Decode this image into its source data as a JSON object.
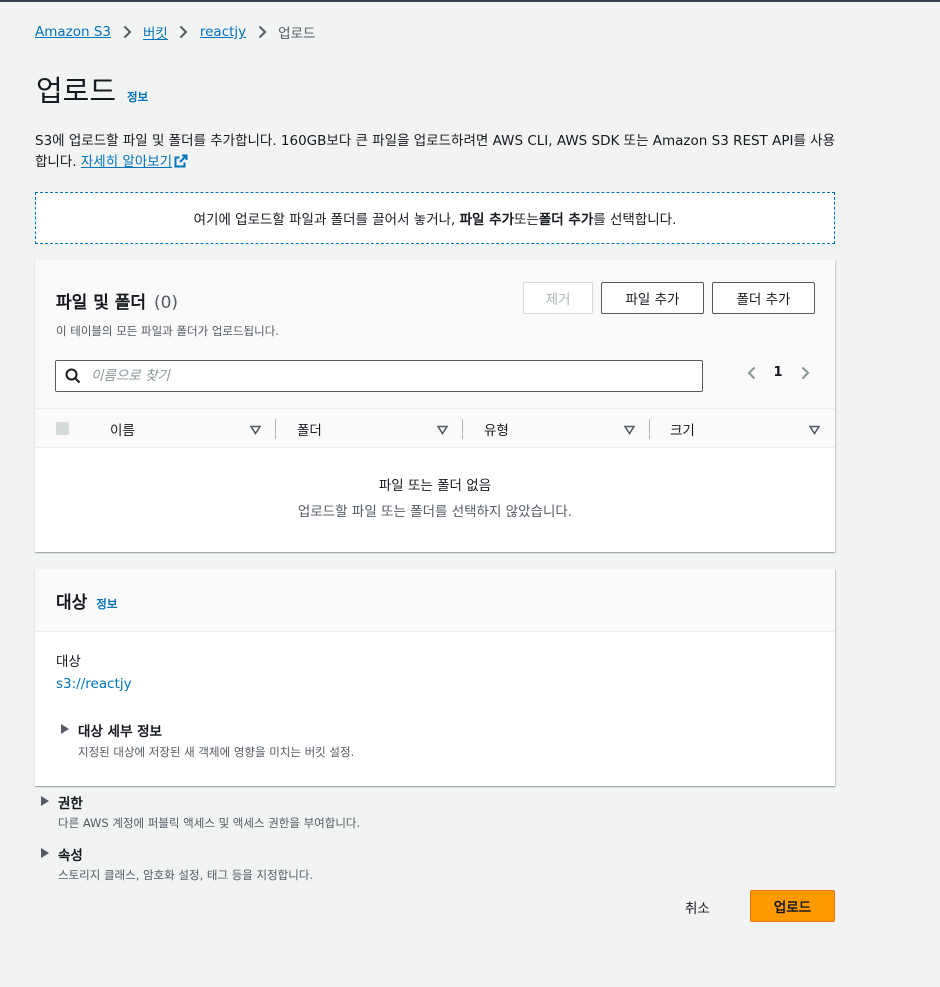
{
  "breadcrumb": {
    "items": [
      "Amazon S3",
      "버킷",
      "reactjy"
    ],
    "current": "업로드"
  },
  "header": {
    "title": "업로드",
    "info": "정보"
  },
  "description": {
    "text": "S3에 업로드할 파일 및 폴더를 추가합니다. 160GB보다 큰 파일을 업로드하려면 AWS CLI, AWS SDK 또는 Amazon S3 REST API를 사용합니다.",
    "link": "자세히 알아보기"
  },
  "dropzone": {
    "prefix": "여기에 업로드할 파일과 폴더를 끌어서 놓거나, ",
    "add_files": "파일 추가",
    "or": " 또는 ",
    "add_folder": "폴더 추가",
    "suffix": "를 선택합니다."
  },
  "files": {
    "title": "파일 및 폴더",
    "count": "(0)",
    "subtitle": "이 테이블의 모든 파일과 폴더가 업로드됩니다.",
    "remove_label": "제거",
    "add_files_label": "파일 추가",
    "add_folder_label": "폴더 추가",
    "search_placeholder": "이름으로 찾기",
    "page": "1",
    "columns": [
      "이름",
      "폴더",
      "유형",
      "크기"
    ],
    "empty_title": "파일 또는 폴더 없음",
    "empty_subtitle": "업로드할 파일 또는 폴더를 선택하지 않았습니다."
  },
  "destination": {
    "title": "대상",
    "info": "정보",
    "label": "대상",
    "value": "s3://reactjy",
    "details_label": "대상 세부 정보",
    "details_sub": "지정된 대상에 저장된 새 객체에 영향을 미치는 버킷 설정."
  },
  "permissions": {
    "label": "권한",
    "sub": "다른 AWS 계정에 퍼블릭 액세스 및 액세스 권한을 부여합니다."
  },
  "properties": {
    "label": "속성",
    "sub": "스토리지 클래스, 암호화 설정, 태그 등을 지정합니다."
  },
  "footer": {
    "cancel": "취소",
    "upload": "업로드"
  },
  "colors": {
    "link": "#0073bb",
    "primary_button": "#ff9900",
    "background": "#f2f3f3"
  }
}
